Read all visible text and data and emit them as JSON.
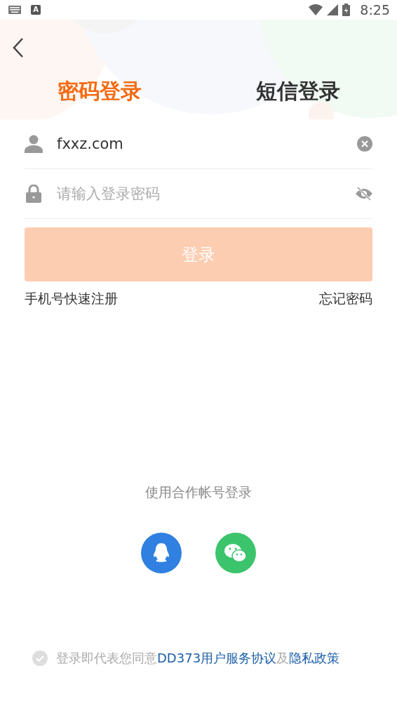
{
  "status_bar": {
    "badge": "A",
    "time": "8:25"
  },
  "tabs": [
    {
      "label": "密码登录",
      "selected": true
    },
    {
      "label": "短信登录",
      "selected": false
    }
  ],
  "username": {
    "value": "fxxz.com"
  },
  "password": {
    "placeholder": "请输入登录密码"
  },
  "login_button": {
    "label": "登录",
    "disabled": true
  },
  "links": {
    "register": "手机号快速注册",
    "forgot": "忘记密码"
  },
  "partner": {
    "title": "使用合作帐号登录",
    "accounts": [
      {
        "kind": "qq"
      },
      {
        "kind": "wechat"
      }
    ]
  },
  "agreement": {
    "checked": false,
    "parts": [
      {
        "kind": "text",
        "text": "登录即代表您同意"
      },
      {
        "kind": "link",
        "text": "DD373用户服务协议"
      },
      {
        "kind": "text",
        "text": "及"
      },
      {
        "kind": "link",
        "text": "隐私政策"
      }
    ]
  }
}
